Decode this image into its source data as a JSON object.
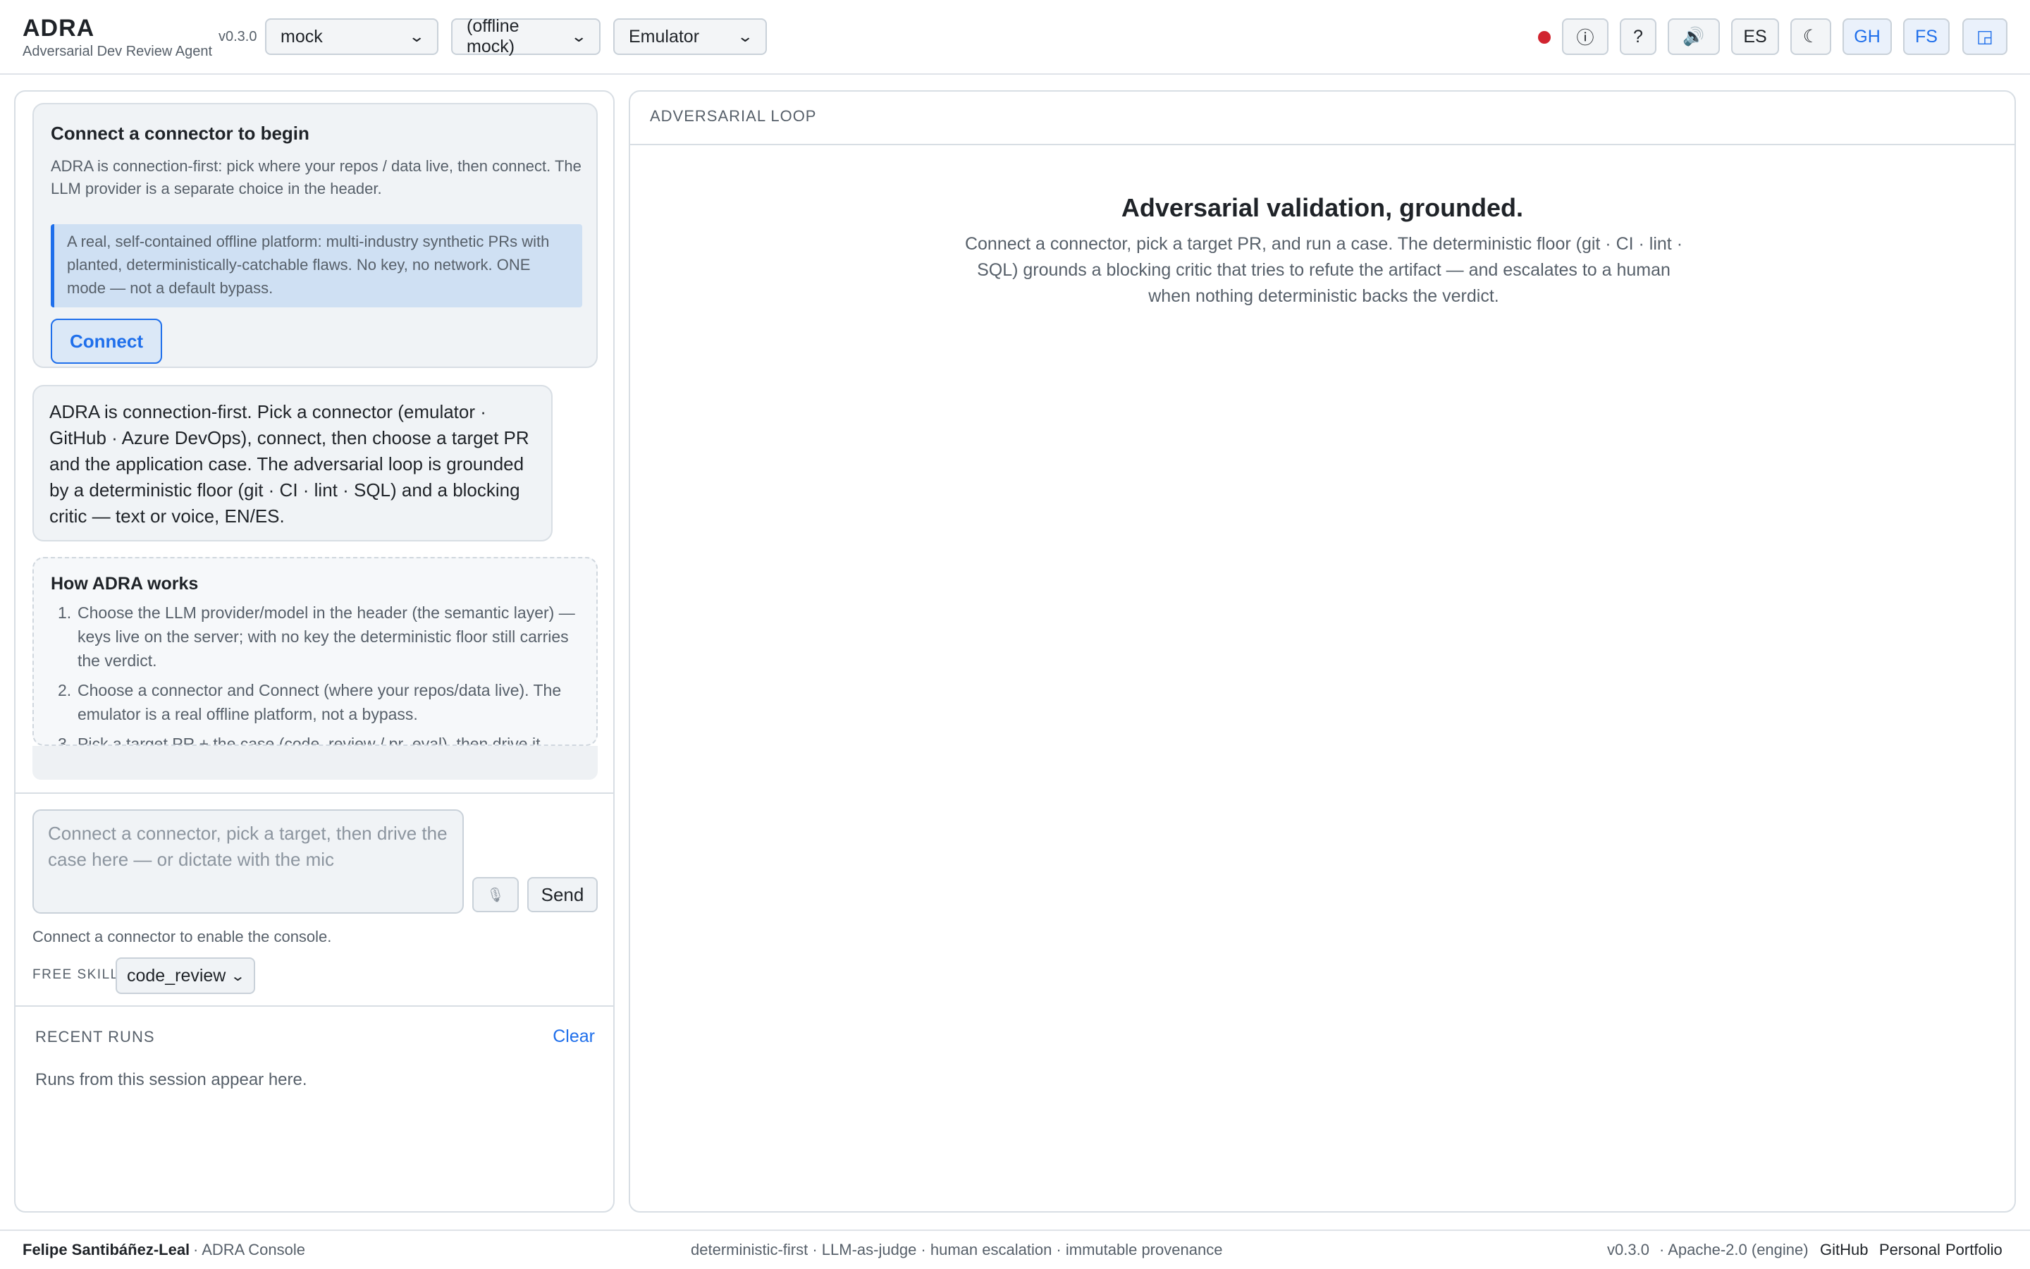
{
  "header": {
    "brand": "ADRA",
    "subtitle": "Adversarial Dev Review Agent",
    "version": "v0.3.0",
    "provider_select": "mock",
    "model_select": "(offline mock)",
    "connector_select": "Emulator",
    "status_color": "#d1242f",
    "buttons": {
      "info": "ⓘ",
      "help": "?",
      "voice": "🔊",
      "language": "ES",
      "theme": "☾",
      "github": "GH",
      "fullscreen": "FS",
      "panel": "◲"
    }
  },
  "connect_card": {
    "title": "Connect a connector to begin",
    "description": "ADRA is connection-first: pick where your repos / data live, then connect. The LLM provider is a separate choice in the header.",
    "info": "A real, self-contained offline platform: multi-industry synthetic PRs with planted, deterministically-catchable flaws. No key, no network. ONE mode — not a default bypass.",
    "button": "Connect"
  },
  "assistant_message": "ADRA is connection-first. Pick a connector (emulator · GitHub · Azure DevOps), connect, then choose a target PR and the application case. The adversarial loop is grounded by a deterministic floor (git · CI · lint · SQL) and a blocking critic — text or voice, EN/ES.",
  "how_it_works": {
    "title": "How ADRA works",
    "steps": [
      {
        "num": "1.",
        "text": "Choose the LLM provider/model in the header (the semantic layer) — keys live on the server; with no key the deterministic floor still carries the verdict."
      },
      {
        "num": "2.",
        "text": "Choose a connector and Connect (where your repos/data live). The emulator is a real offline platform, not a bypass."
      },
      {
        "num": "3.",
        "text": "Pick a target PR + the case (code_review / pr_eval), then drive it"
      }
    ]
  },
  "composer": {
    "placeholder": "Connect a connector, pick a target, then drive the case here — or dictate with the mic",
    "mic": "🎙",
    "send": "Send",
    "note": "Connect a connector to enable the console.",
    "skill_label": "FREE SKILL",
    "skill_value": "code_review"
  },
  "recent_runs": {
    "title": "RECENT RUNS",
    "clear": "Clear",
    "empty": "Runs from this session appear here."
  },
  "main": {
    "section_title": "ADVERSARIAL LOOP",
    "hero_title": "Adversarial validation, grounded.",
    "hero_desc": "Connect a connector, pick a target PR, and run a case. The deterministic floor (git · CI · lint · SQL) grounds a blocking critic that tries to refute the artifact — and escalates to a human when nothing deterministic backs the verdict."
  },
  "footer": {
    "owner": "Felipe Santibáñez-Leal",
    "app": "· ADRA Console",
    "tagline": "deterministic-first · LLM-as-judge · human escalation · immutable provenance",
    "version": "v0.3.0",
    "license": "· Apache-2.0 (engine)",
    "links": [
      "GitHub",
      "Personal",
      "Portfolio"
    ]
  },
  "colors": {
    "accent": "#1f6feb",
    "status_offline": "#d1242f"
  }
}
